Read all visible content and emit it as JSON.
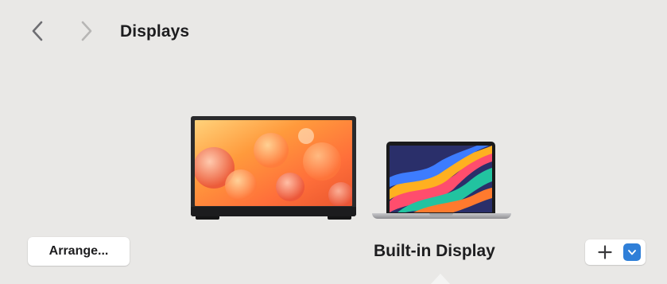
{
  "header": {
    "title": "Displays",
    "back_icon": "chevron-left-icon",
    "forward_icon": "chevron-right-icon"
  },
  "displays": [
    {
      "kind": "external-monitor",
      "selected": false
    },
    {
      "kind": "built-in-laptop",
      "selected": true
    }
  ],
  "toolbar": {
    "arrange_label": "Arrange...",
    "selected_display_name": "Built-in Display",
    "add_icon": "plus-icon",
    "menu_icon": "chevron-down-icon"
  },
  "colors": {
    "background": "#e9e8e6",
    "accent": "#2f7fd8",
    "button_bg": "#ffffff"
  }
}
